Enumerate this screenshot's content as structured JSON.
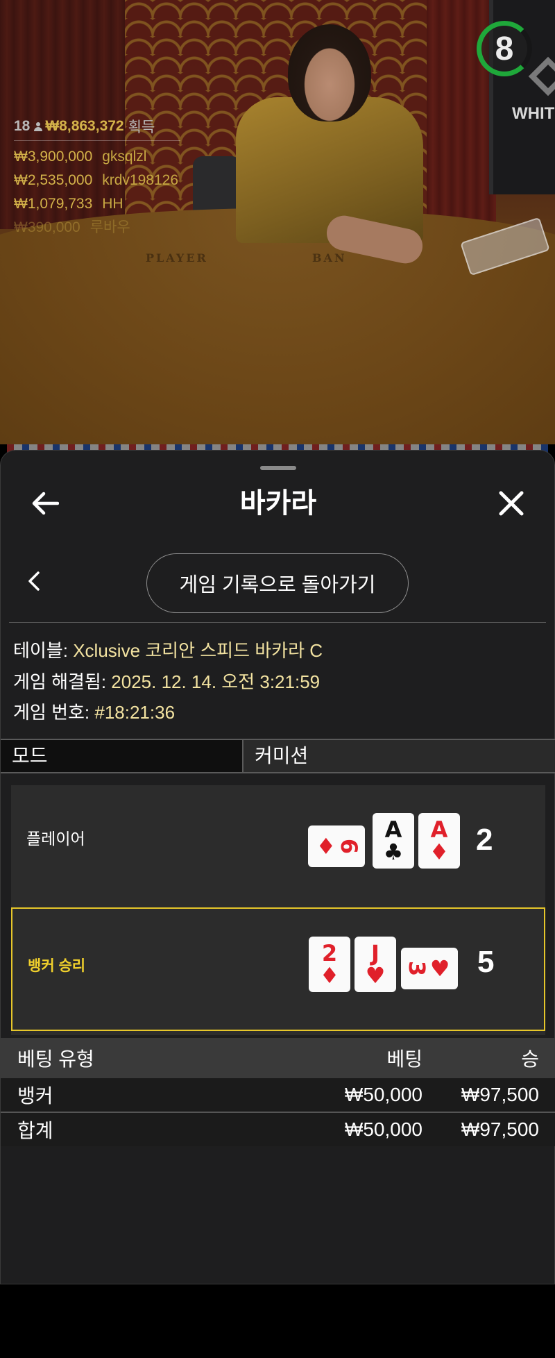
{
  "video": {
    "timer": "8",
    "monitor_text": "WHITE",
    "felt_player": "PLAYER",
    "felt_banker": "BAN",
    "winners": {
      "count": "18",
      "total": "₩8,863,372",
      "total_suffix": "획득",
      "rows": [
        {
          "amount": "₩3,900,000",
          "name": "gksqlzl"
        },
        {
          "amount": "₩2,535,000",
          "name": "krdv198126"
        },
        {
          "amount": "₩1,079,733",
          "name": "HH"
        },
        {
          "amount": "₩390,000",
          "name": "루바우"
        }
      ]
    }
  },
  "sheet": {
    "title": "바카라",
    "history_button": "게임 기록으로 돌아가기",
    "info": {
      "table_label": "테이블: ",
      "table_value": "Xclusive 코리안 스피드 바카라 C",
      "resolved_label": "게임 해결됨: ",
      "resolved_value": "2025. 12. 14. 오전 3:21:59",
      "number_label": "게임 번호: ",
      "number_value": "#18:21:36"
    },
    "segments": {
      "mode": "모드",
      "commission": "커미션"
    },
    "player": {
      "label": "플레이어",
      "score": "2",
      "cards": [
        {
          "rank": "6",
          "suit": "♦",
          "color": "red",
          "sideways": true
        },
        {
          "rank": "A",
          "suit": "♣",
          "color": "black",
          "sideways": false
        },
        {
          "rank": "A",
          "suit": "♦",
          "color": "red",
          "sideways": false
        }
      ]
    },
    "banker": {
      "label": "뱅커 승리",
      "score": "5",
      "cards": [
        {
          "rank": "2",
          "suit": "♦",
          "color": "red",
          "sideways": false
        },
        {
          "rank": "J",
          "suit": "♥",
          "color": "red",
          "sideways": false
        },
        {
          "rank": "3",
          "suit": "♥",
          "color": "red",
          "sideways": true
        }
      ]
    },
    "bets": {
      "headers": {
        "type": "베팅 유형",
        "bet": "베팅",
        "win": "승"
      },
      "rows": [
        {
          "type": "뱅커",
          "bet": "₩50,000",
          "win": "₩97,500"
        }
      ],
      "total": {
        "type": "합계",
        "bet": "₩50,000",
        "win": "₩97,500"
      }
    }
  },
  "colors": {
    "accent_gold": "#f0d02c",
    "timer_green": "#1fa83a",
    "info_value": "#f3e3a1"
  }
}
